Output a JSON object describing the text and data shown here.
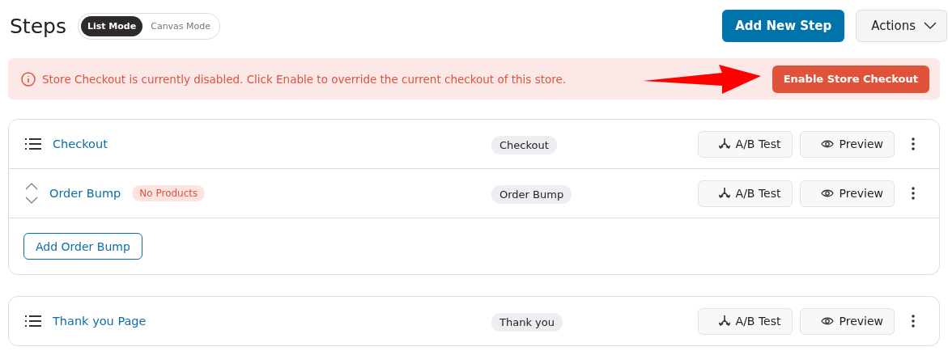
{
  "header": {
    "title": "Steps",
    "modes": [
      {
        "label": "List Mode",
        "selected": true
      },
      {
        "label": "Canvas Mode",
        "selected": false
      }
    ],
    "add_button": "Add New Step",
    "actions_button": "Actions"
  },
  "notice": {
    "message": "Store Checkout is currently disabled. Click Enable to override the current checkout of this store.",
    "button": "Enable Store Checkout"
  },
  "groups": [
    {
      "steps": [
        {
          "kind": "step",
          "title": "Checkout",
          "type": "Checkout",
          "ab_test": "A/B Test",
          "preview": "Preview"
        },
        {
          "kind": "bump",
          "title": "Order Bump",
          "badge": "No Products",
          "type": "Order Bump",
          "ab_test": "A/B Test",
          "preview": "Preview"
        }
      ],
      "add_button": "Add Order Bump"
    },
    {
      "steps": [
        {
          "kind": "step",
          "title": "Thank you Page",
          "type": "Thank you",
          "ab_test": "A/B Test",
          "preview": "Preview"
        }
      ]
    }
  ]
}
